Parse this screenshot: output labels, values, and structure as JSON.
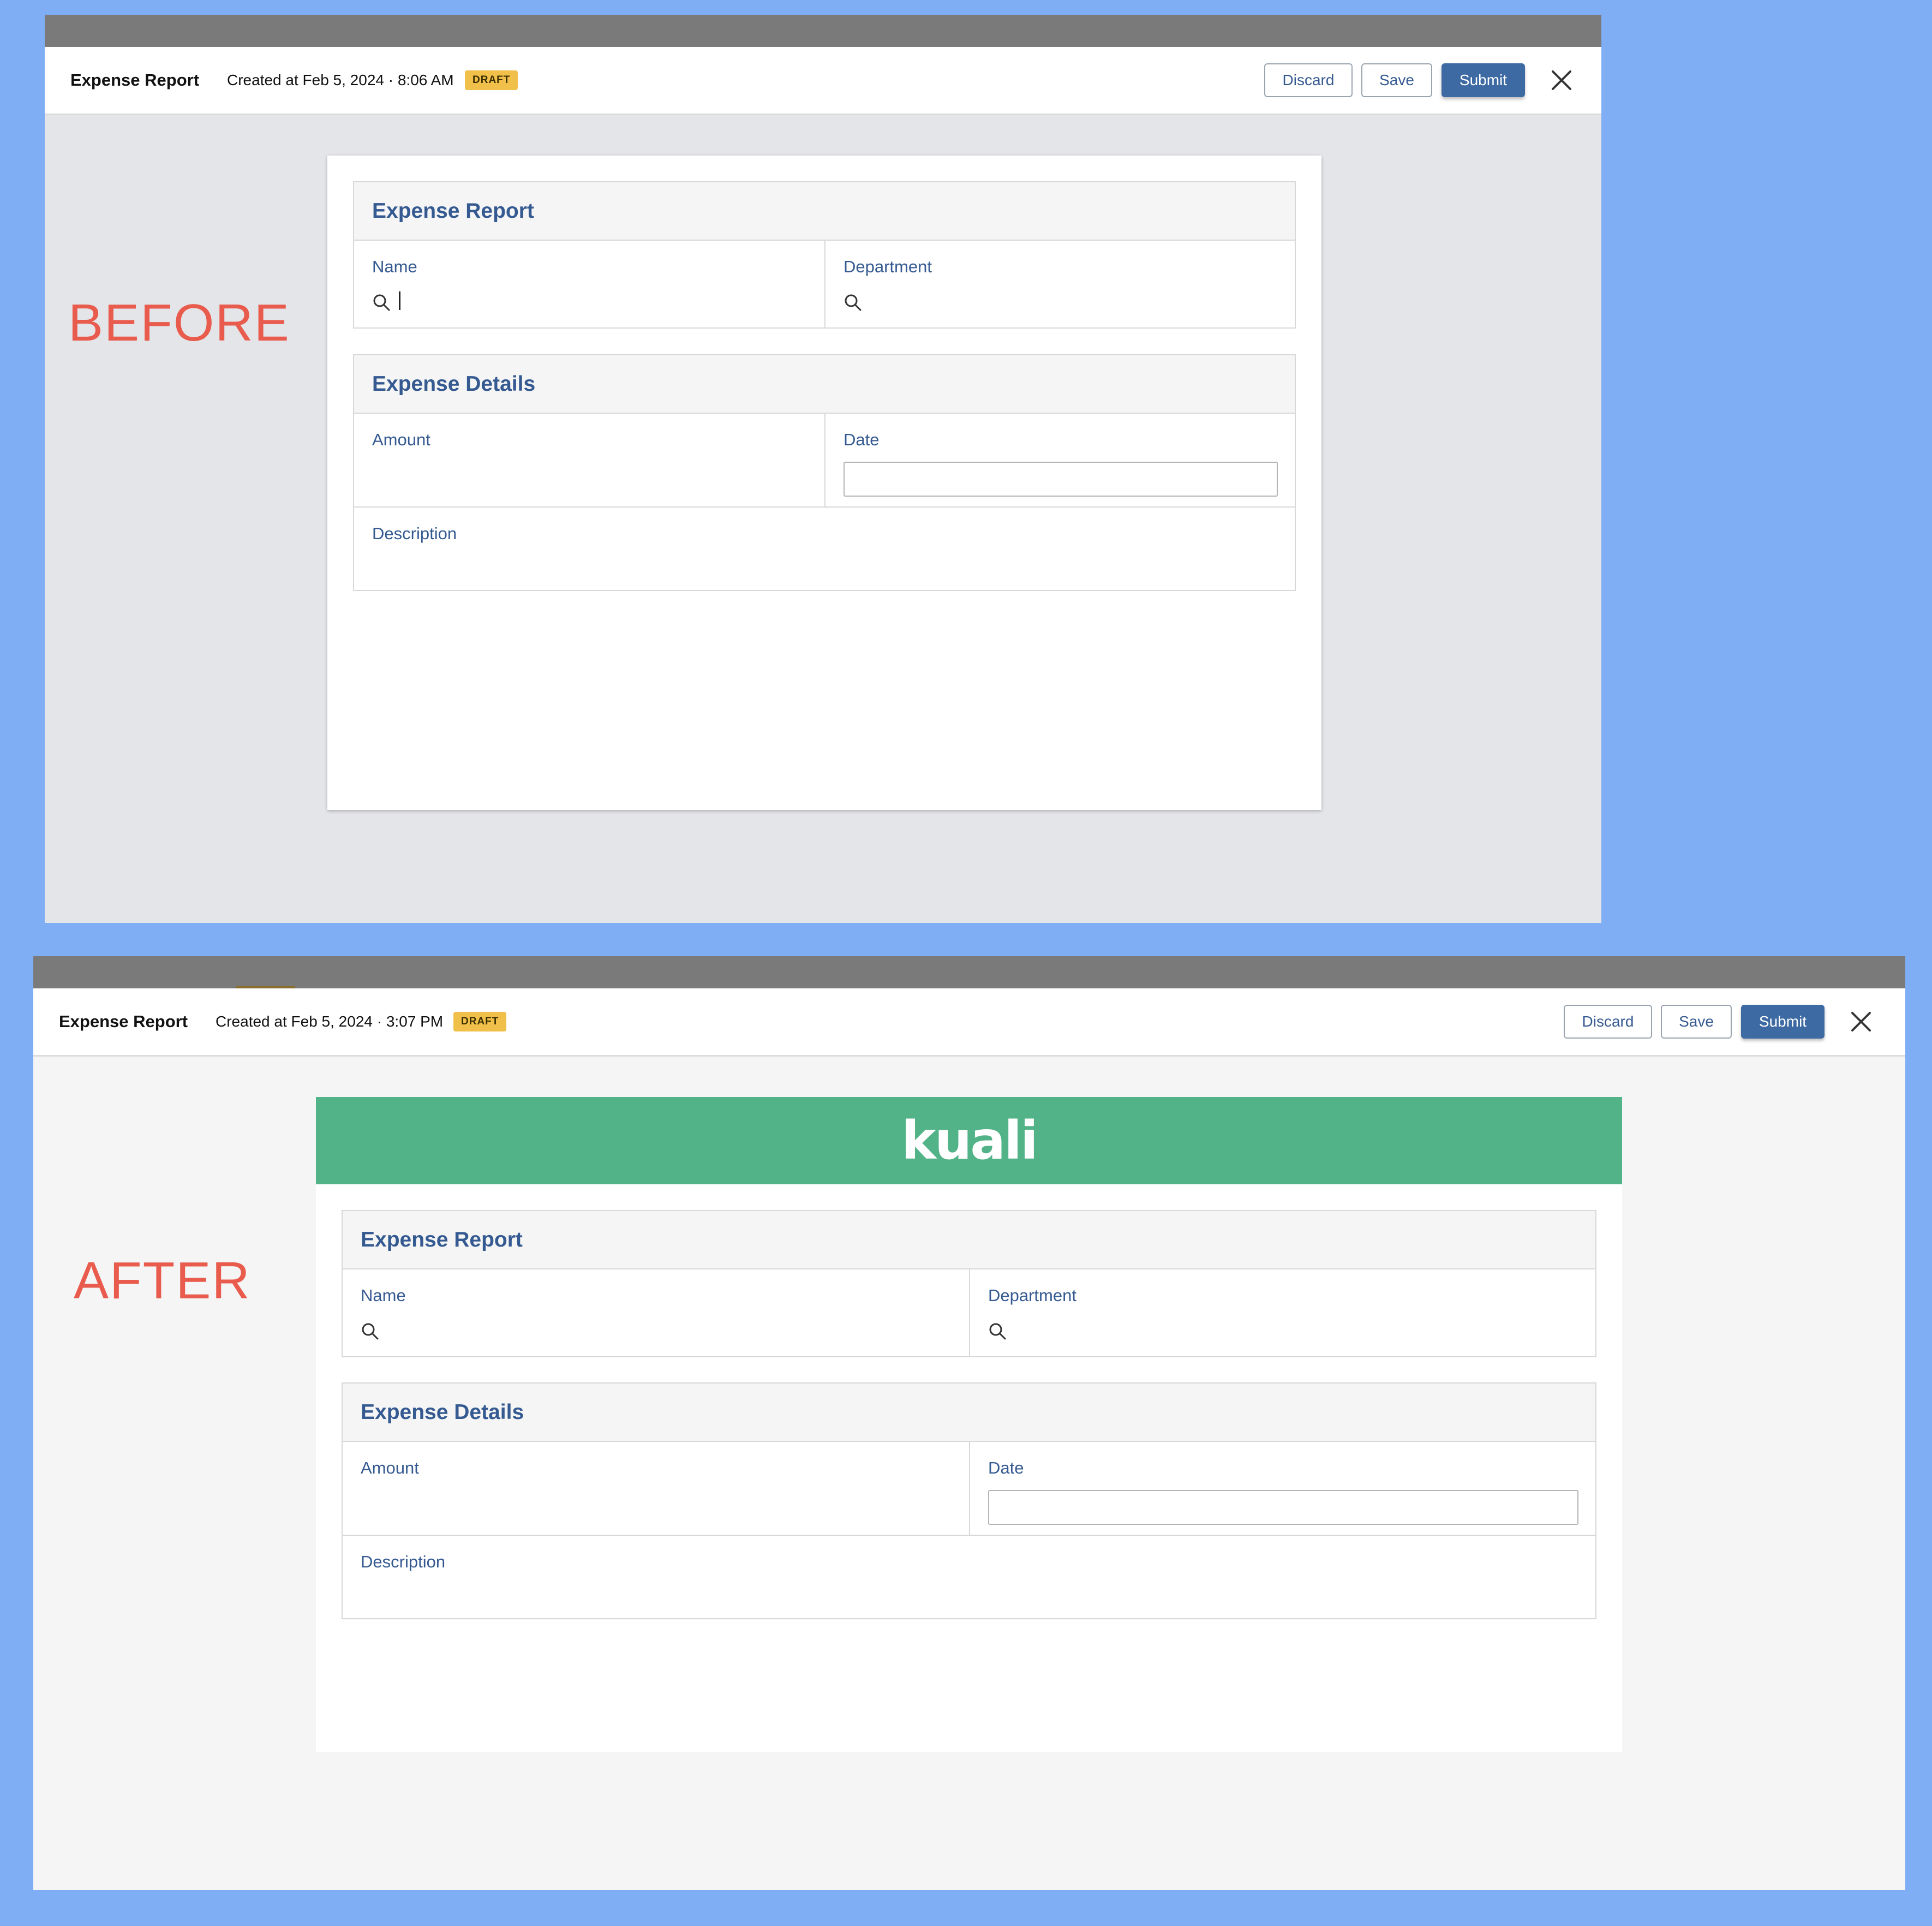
{
  "before": {
    "label": "BEFORE",
    "header": {
      "title": "Expense Report",
      "created": "Created at Feb 5, 2024 · 8:06 AM",
      "status_badge": "DRAFT"
    },
    "buttons": {
      "discard": "Discard",
      "save": "Save",
      "submit": "Submit"
    },
    "form": {
      "section1": {
        "title": "Expense Report",
        "name_label": "Name",
        "department_label": "Department"
      },
      "section2": {
        "title": "Expense Details",
        "amount_label": "Amount",
        "date_label": "Date",
        "description_label": "Description"
      }
    }
  },
  "after": {
    "label": "AFTER",
    "header": {
      "title": "Expense Report",
      "created": "Created at Feb 5, 2024 · 3:07 PM",
      "status_badge": "DRAFT"
    },
    "buttons": {
      "discard": "Discard",
      "save": "Save",
      "submit": "Submit"
    },
    "logo_text": "kuali",
    "form": {
      "section1": {
        "title": "Expense Report",
        "name_label": "Name",
        "department_label": "Department"
      },
      "section2": {
        "title": "Expense Details",
        "amount_label": "Amount",
        "date_label": "Date",
        "description_label": "Description"
      }
    }
  },
  "colors": {
    "page_background": "#80aef5",
    "accent_blue": "#3d6aa3",
    "label_red": "#e85b4d",
    "draft_badge": "#f0c04a",
    "kuali_green": "#52b288"
  },
  "icons": [
    "search-icon",
    "close-icon"
  ]
}
